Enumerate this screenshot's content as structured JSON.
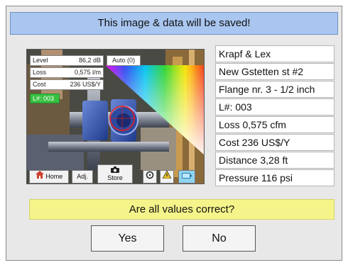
{
  "dialog": {
    "title": "This image & data will be saved!"
  },
  "camera": {
    "readouts": [
      {
        "label": "Level",
        "value": "86,2 dB"
      },
      {
        "label": "Loss",
        "value": "0,575 l/m"
      },
      {
        "label": "Cost",
        "value": "236 US$/Y"
      }
    ],
    "auto_label": "Auto (0)",
    "lnum_label": "L#: 003",
    "toolbar": {
      "home_label": "Home",
      "adj_label": "Adj.",
      "store_label": "Store"
    }
  },
  "info": {
    "rows": [
      "Krapf & Lex",
      "New Gstetten st #2",
      "Flange nr. 3 - 1/2 inch",
      "L#: 003",
      "Loss 0,575 cfm",
      "Cost 236 US$/Y",
      "Distance 3,28 ft",
      "Pressure 116 psi"
    ]
  },
  "prompt": {
    "question": "Are all values correct?"
  },
  "buttons": {
    "yes_label": "Yes",
    "no_label": "No"
  }
}
